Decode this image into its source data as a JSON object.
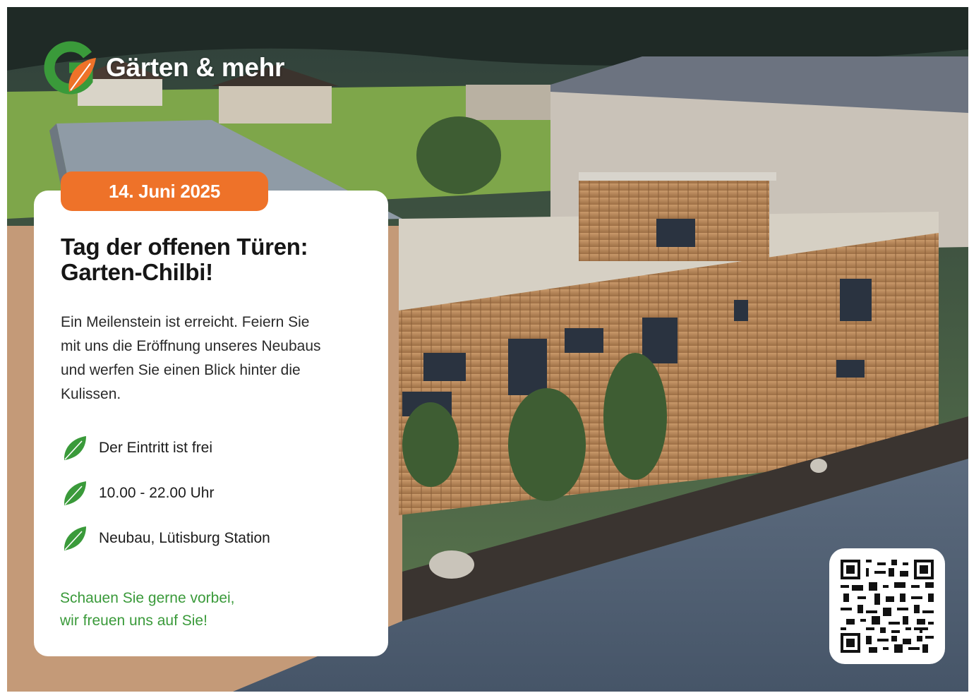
{
  "brand": {
    "name": "Gärten & mehr",
    "colors": {
      "green": "#3a9a3a",
      "orange": "#ee7229"
    }
  },
  "event": {
    "date": "14. Juni 2025",
    "title_line1": "Tag der offenen Türen:",
    "title_line2": "Garten-Chilbi!",
    "intro_lines": [
      "Ein Meilenstein ist erreicht. Feiern Sie",
      "mit uns die Eröffnung unseres Neubaus",
      "und werfen Sie einen Blick hinter die",
      "Kulissen."
    ],
    "facts": [
      {
        "icon": "leaf-icon",
        "text": "Der Eintritt ist frei"
      },
      {
        "icon": "leaf-icon",
        "text": "10.00 - 22.00 Uhr"
      },
      {
        "icon": "leaf-icon",
        "text": "Neubau, Lütisburg Station"
      }
    ],
    "closing_line1": "Schauen Sie gerne vorbei,",
    "closing_line2": "wir freuen uns auf Sie!"
  },
  "qr": {
    "icon": "qr-code-icon"
  }
}
